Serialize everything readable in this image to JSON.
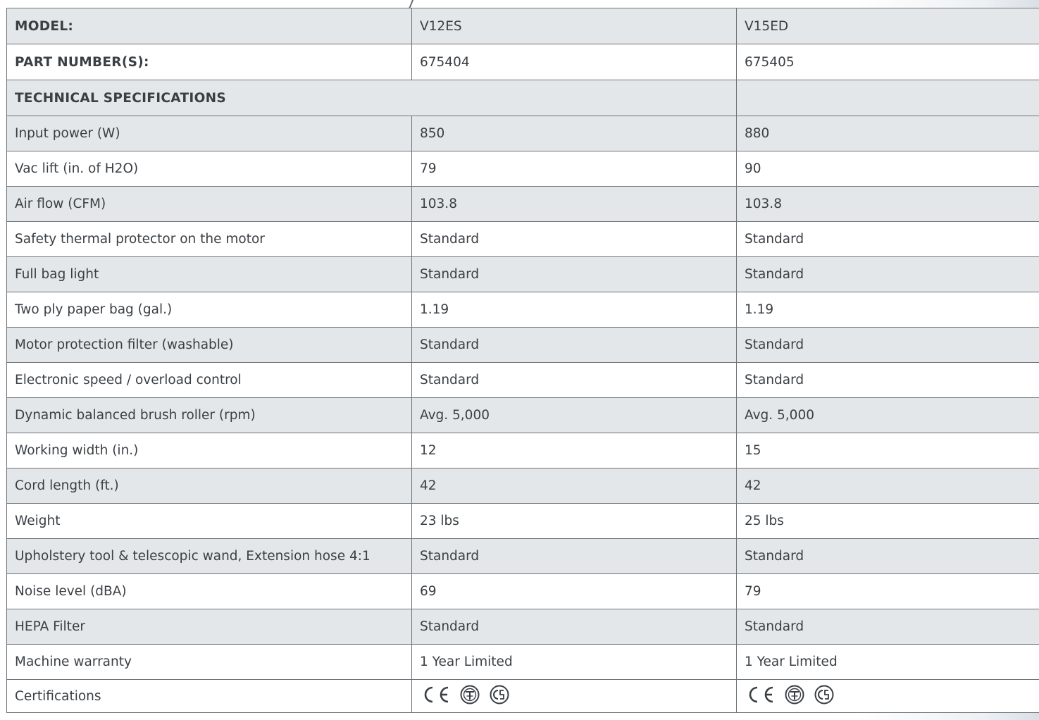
{
  "header": {
    "model_label": "MODEL:",
    "part_label": "PART NUMBER(S):",
    "section_label": "TECHNICAL SPECIFICATIONS"
  },
  "models": [
    {
      "name": "V12ES",
      "part": "675404"
    },
    {
      "name": "V15ED",
      "part": "675405"
    }
  ],
  "specs": [
    {
      "label": "Input power (W)",
      "v1": "850",
      "v2": "880"
    },
    {
      "label": "Vac lift (in. of H2O)",
      "v1": "79",
      "v2": "90"
    },
    {
      "label": "Air flow (CFM)",
      "v1": "103.8",
      "v2": "103.8"
    },
    {
      "label": "Safety thermal protector on the motor",
      "v1": "Standard",
      "v2": "Standard"
    },
    {
      "label": "Full bag light",
      "v1": "Standard",
      "v2": "Standard"
    },
    {
      "label": "Two ply paper bag (gal.)",
      "v1": "1.19",
      "v2": "1.19"
    },
    {
      "label": "Motor protection filter (washable)",
      "v1": "Standard",
      "v2": "Standard"
    },
    {
      "label": "Electronic speed / overload control",
      "v1": "Standard",
      "v2": "Standard"
    },
    {
      "label": "Dynamic balanced brush roller (rpm)",
      "v1": "Avg. 5,000",
      "v2": "Avg. 5,000"
    },
    {
      "label": "Working width (in.)",
      "v1": "12",
      "v2": "15"
    },
    {
      "label": "Cord length (ft.)",
      "v1": "42",
      "v2": "42"
    },
    {
      "label": "Weight",
      "v1": "23 lbs",
      "v2": "25 lbs"
    },
    {
      "label": "Upholstery tool & telescopic wand, Extension hose 4:1",
      "v1": "Standard",
      "v2": "Standard"
    },
    {
      "label": "Noise level (dBA)",
      "v1": "69",
      "v2": "79"
    },
    {
      "label": "HEPA Filter",
      "v1": "Standard",
      "v2": "Standard"
    },
    {
      "label": "Machine warranty",
      "v1": "1 Year Limited",
      "v2": "1 Year Limited"
    }
  ],
  "certifications": {
    "label": "Certifications",
    "icons": [
      "ce-mark-icon",
      "etl-mark-icon",
      "csa-mark-icon"
    ]
  },
  "colors": {
    "heading": "#123f80",
    "row_shade": "#e4e7ea",
    "border": "#6d7378",
    "text": "#3a3f44"
  }
}
